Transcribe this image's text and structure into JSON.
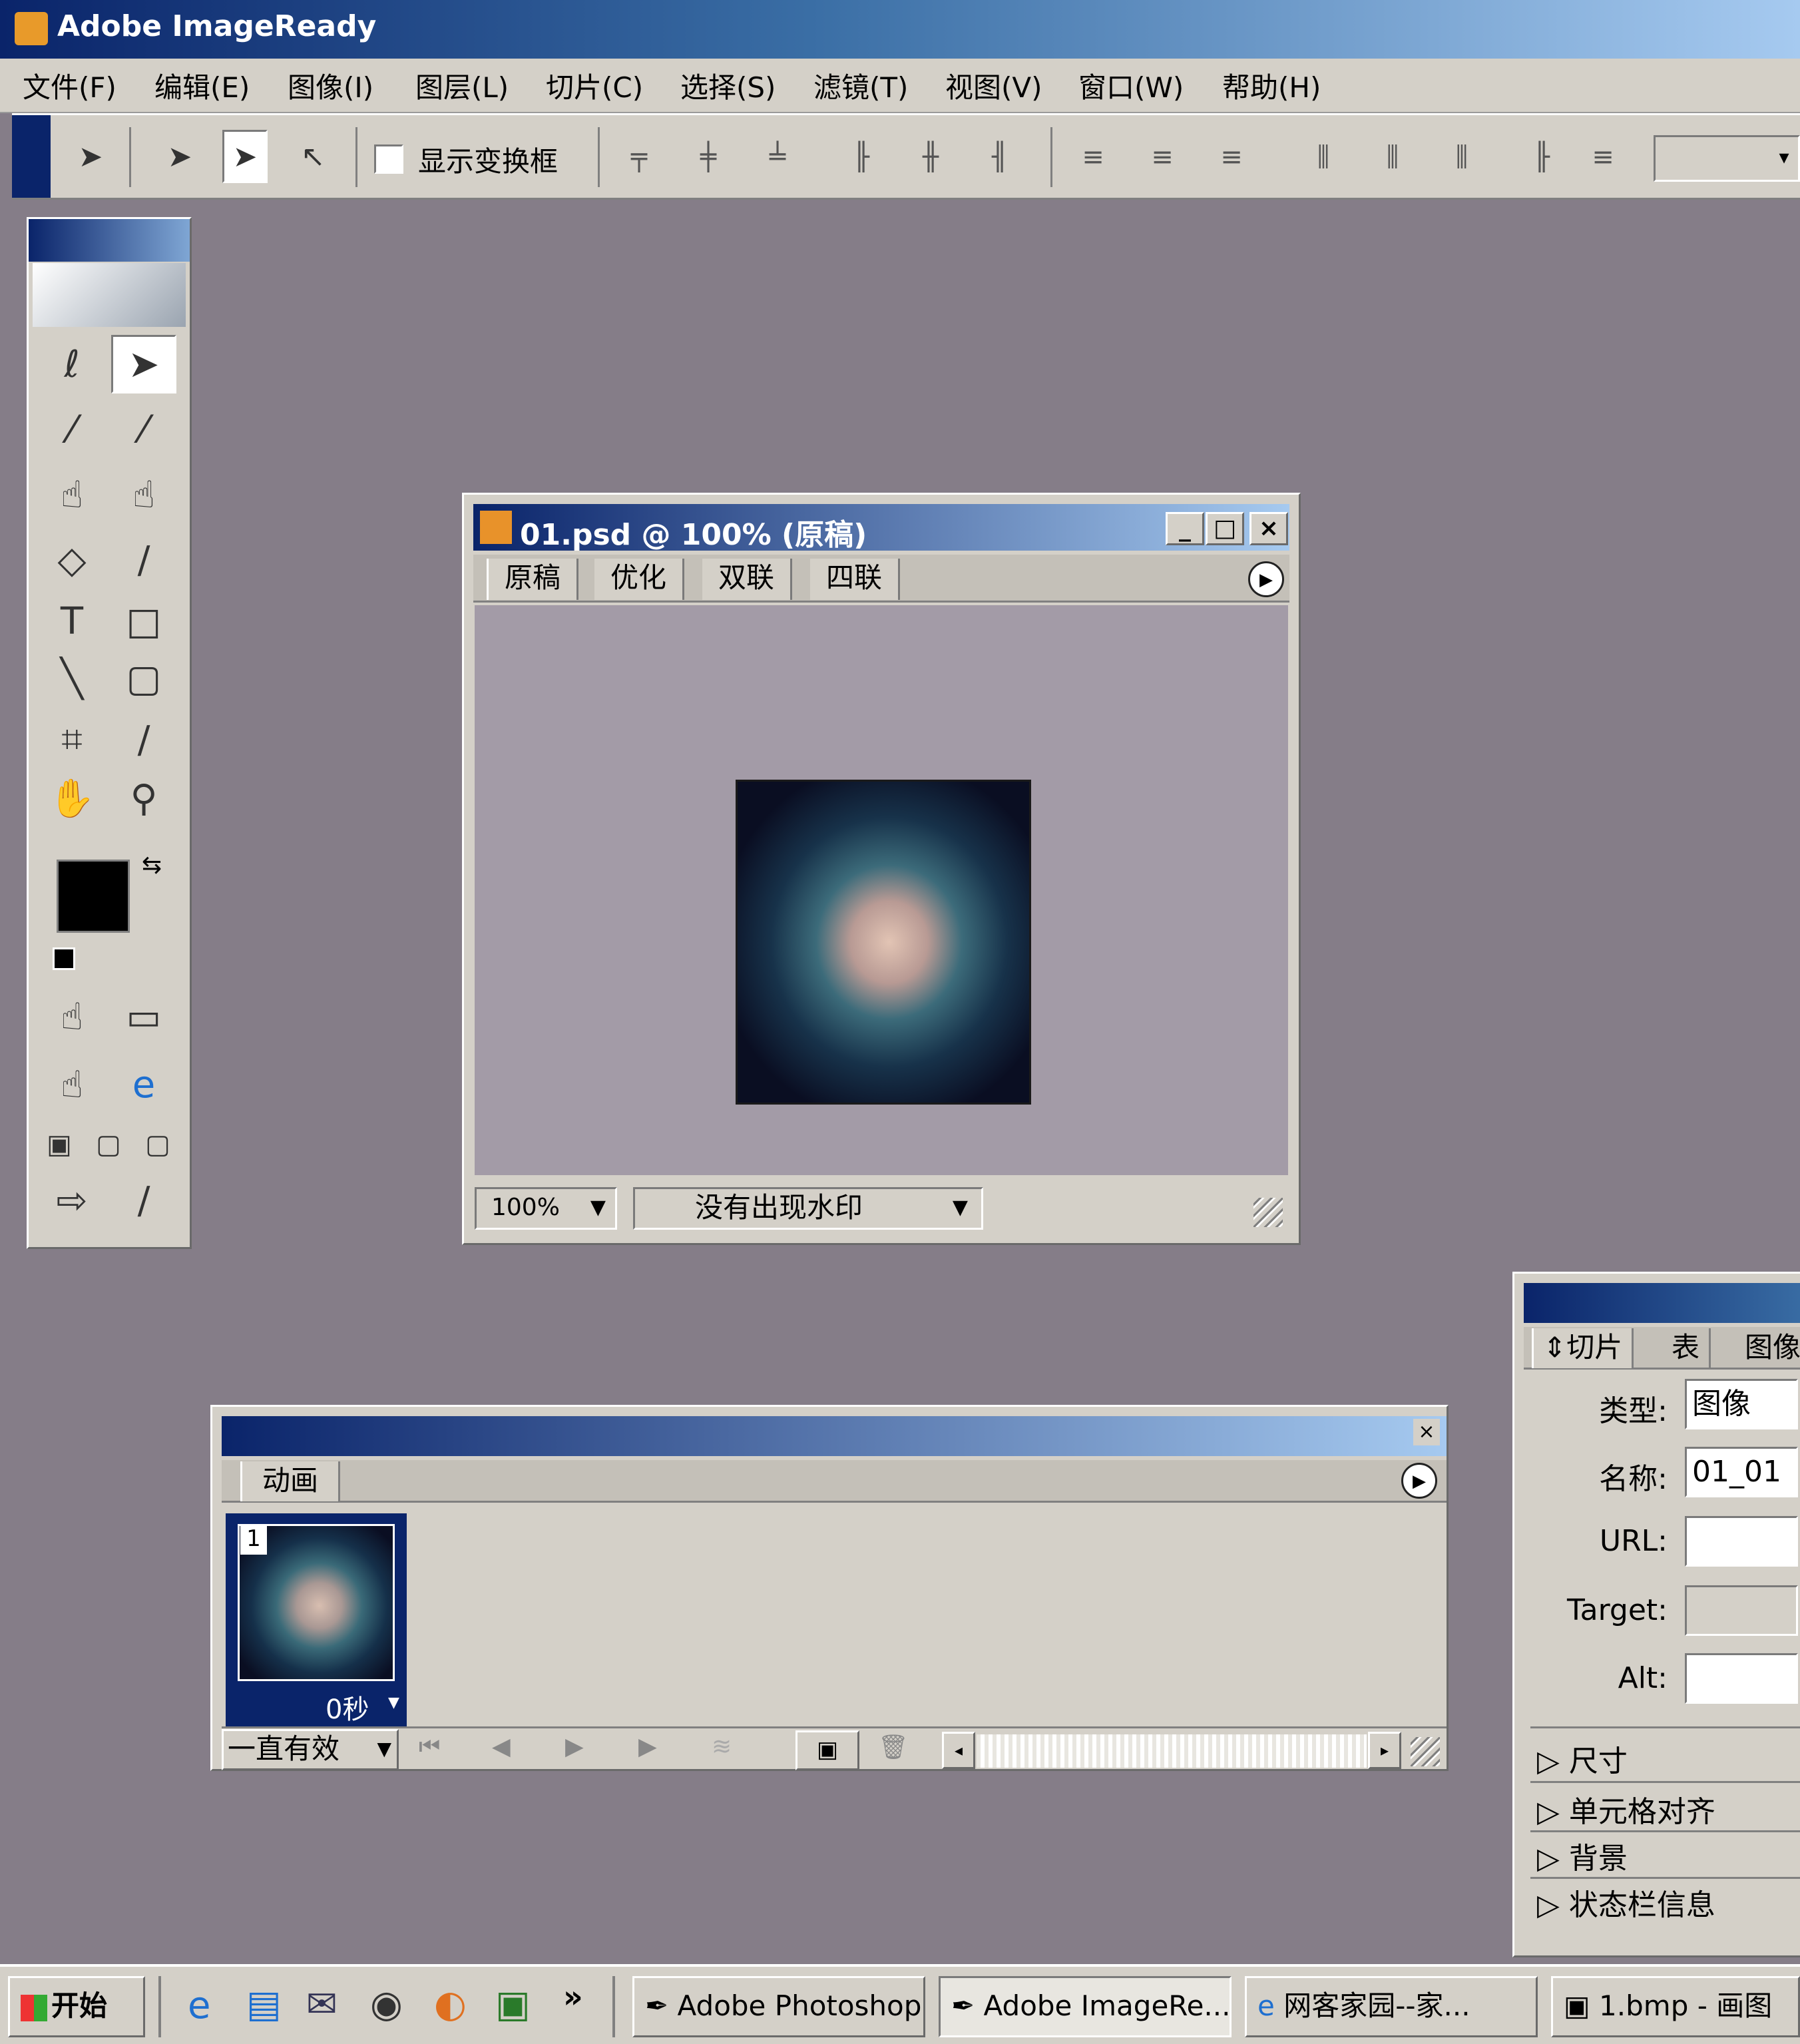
{
  "window": {
    "title": "Adobe ImageReady"
  },
  "menu": [
    "文件(F)",
    "编辑(E)",
    "图像(I)",
    "图层(L)",
    "切片(C)",
    "选择(S)",
    "滤镜(T)",
    "视图(V)",
    "窗口(W)",
    "帮助(H)"
  ],
  "options_bar": {
    "show_transform_label": "显示变换框",
    "show_transform_checked": false
  },
  "document": {
    "title": "01.psd @ 100% (原稿)",
    "tabs": [
      "原稿",
      "优化",
      "双联",
      "四联"
    ],
    "active_tab": "原稿",
    "zoom": "100%",
    "watermark": "没有出现水印"
  },
  "animation": {
    "tab": "动画",
    "frame_number": "1",
    "frame_delay": "0秒",
    "loop": "一直有效"
  },
  "slice_panel": {
    "tabs": [
      "切片",
      "表",
      "图像"
    ],
    "type_label": "类型:",
    "type_value": "图像",
    "name_label": "名称:",
    "name_value": "01_01",
    "url_label": "URL:",
    "url_value": "",
    "target_label": "Target:",
    "target_value": "",
    "alt_label": "Alt:",
    "alt_value": "",
    "sections": [
      "尺寸",
      "单元格对齐",
      "背景",
      "状态栏信息"
    ]
  },
  "taskbar": {
    "start": "开始",
    "quick_launch_more": "»",
    "tasks": [
      "Adobe Photoshop",
      "Adobe ImageRe...",
      "网客家园--家...",
      "1.bmp - 画图"
    ]
  },
  "colors": {
    "foreground": "#000000",
    "background": "#ffffff",
    "desktop": "#857d88",
    "canvas": "#a39ba7"
  }
}
